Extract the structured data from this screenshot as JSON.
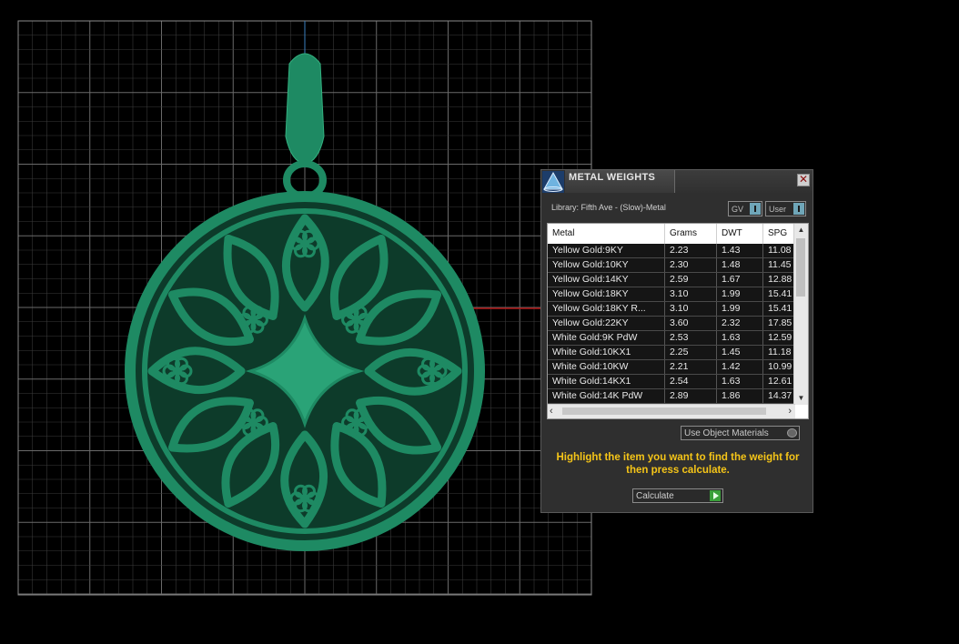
{
  "viewport": {
    "name": "3D viewport",
    "colors": {
      "background": "#000000",
      "grid": "#5a5a5a",
      "model": "#1e8a63",
      "axis_red": "#b01515",
      "axis_blue": "#3a7fbf"
    }
  },
  "panel": {
    "title": "METAL WEIGHTS",
    "close_symbol": "✕",
    "library_label": "Library: Fifth Ave - (Slow)-Metal",
    "toggles": {
      "gv_label": "GV",
      "user_label": "User"
    },
    "table": {
      "columns": [
        "Metal",
        "Grams",
        "DWT",
        "SPG"
      ],
      "rows": [
        {
          "metal": "Yellow Gold:9KY",
          "grams": "2.23",
          "dwt": "1.43",
          "spg": "11.08"
        },
        {
          "metal": "Yellow Gold:10KY",
          "grams": "2.30",
          "dwt": "1.48",
          "spg": "11.45"
        },
        {
          "metal": "Yellow Gold:14KY",
          "grams": "2.59",
          "dwt": "1.67",
          "spg": "12.88"
        },
        {
          "metal": "Yellow Gold:18KY",
          "grams": "3.10",
          "dwt": "1.99",
          "spg": "15.41"
        },
        {
          "metal": "Yellow Gold:18KY R...",
          "grams": "3.10",
          "dwt": "1.99",
          "spg": "15.41"
        },
        {
          "metal": "Yellow Gold:22KY",
          "grams": "3.60",
          "dwt": "2.32",
          "spg": "17.85"
        },
        {
          "metal": "White Gold:9K PdW",
          "grams": "2.53",
          "dwt": "1.63",
          "spg": "12.59"
        },
        {
          "metal": "White Gold:10KX1",
          "grams": "2.25",
          "dwt": "1.45",
          "spg": "11.18"
        },
        {
          "metal": "White Gold:10KW",
          "grams": "2.21",
          "dwt": "1.42",
          "spg": "10.99"
        },
        {
          "metal": "White Gold:14KX1",
          "grams": "2.54",
          "dwt": "1.63",
          "spg": "12.61"
        },
        {
          "metal": "White Gold:14K PdW",
          "grams": "2.89",
          "dwt": "1.86",
          "spg": "14.37"
        }
      ]
    },
    "use_object_materials_label": "Use Object Materials",
    "instruction": "Highlight the item you want to find the weight for then press calculate.",
    "calculate_label": "Calculate",
    "colors": {
      "panel_bg": "#2f2f2f",
      "instruction": "#f5c518",
      "toggle_knob": "#6fa6b8",
      "calculate_arrow": "#3aa03a"
    },
    "icons": {
      "logo": "pyramid-logo-icon",
      "close": "close-icon",
      "calculate": "play-arrow-icon"
    }
  }
}
